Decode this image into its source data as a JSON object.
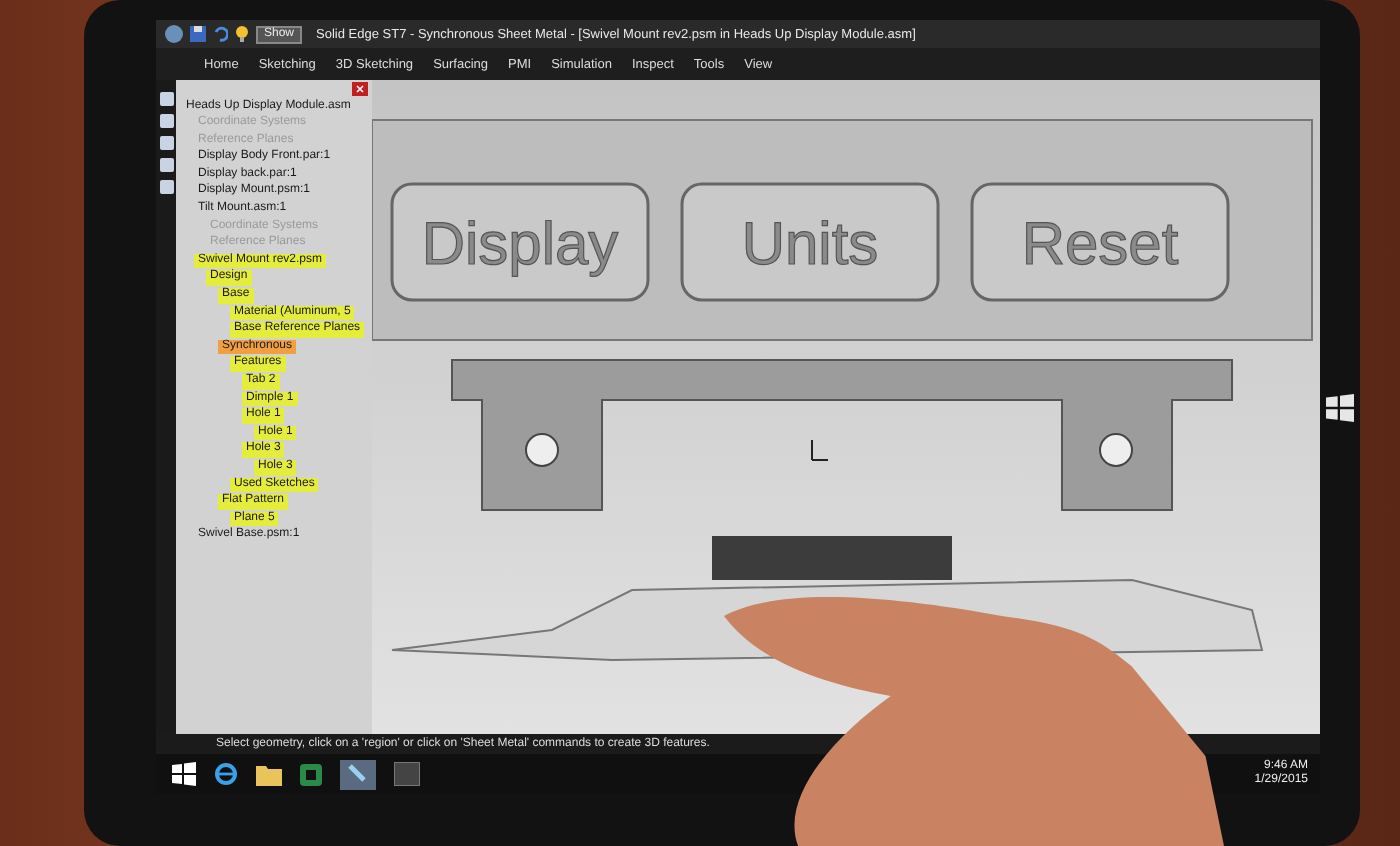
{
  "window": {
    "title": "Solid Edge ST7 - Synchronous Sheet Metal - [Swivel Mount rev2.psm in Heads Up Display Module.asm]",
    "show_button": "Show"
  },
  "ribbon_tabs": [
    {
      "label": "Home",
      "selected": false
    },
    {
      "label": "Sketching",
      "selected": false
    },
    {
      "label": "3D Sketching",
      "selected": false
    },
    {
      "label": "Surfacing",
      "selected": false
    },
    {
      "label": "PMI",
      "selected": false
    },
    {
      "label": "Simulation",
      "selected": false
    },
    {
      "label": "Inspect",
      "selected": false
    },
    {
      "label": "Tools",
      "selected": false
    },
    {
      "label": "View",
      "selected": false
    }
  ],
  "tree": [
    {
      "label": "Heads Up Display Module.asm",
      "disabled": false,
      "children": [
        {
          "label": "Coordinate Systems",
          "disabled": true
        },
        {
          "label": "Reference Planes",
          "disabled": true
        },
        {
          "label": "Display Body Front.par:1",
          "disabled": false
        },
        {
          "label": "Display back.par:1",
          "disabled": false
        },
        {
          "label": "Display Mount.psm:1",
          "disabled": false
        },
        {
          "label": "Tilt Mount.asm:1",
          "disabled": false,
          "children": [
            {
              "label": "Coordinate Systems",
              "disabled": true
            },
            {
              "label": "Reference Planes",
              "disabled": true
            }
          ]
        },
        {
          "label": "Swivel Mount rev2.psm",
          "disabled": false,
          "color": "#e4ec3c",
          "children": [
            {
              "label": "Design",
              "disabled": false,
              "color": "#e4ec3c",
              "children": [
                {
                  "label": "Base",
                  "disabled": false,
                  "color": "#e4ec3c",
                  "children": [
                    {
                      "label": "Material (Aluminum, 5",
                      "disabled": false,
                      "color": "#e4ec3c"
                    },
                    {
                      "label": "Base Reference Planes",
                      "disabled": false,
                      "color": "#e4ec3c"
                    }
                  ]
                },
                {
                  "label": "Synchronous",
                  "disabled": false,
                  "color": "#f0a040",
                  "children": [
                    {
                      "label": "Features",
                      "disabled": false,
                      "color": "#e4ec3c",
                      "children": [
                        {
                          "label": "Tab 2",
                          "disabled": false,
                          "color": "#e4ec3c"
                        },
                        {
                          "label": "Dimple 1",
                          "disabled": false,
                          "color": "#e4ec3c"
                        },
                        {
                          "label": "Hole 1",
                          "disabled": false,
                          "color": "#e4ec3c",
                          "children": [
                            {
                              "label": "Hole 1",
                              "disabled": false,
                              "color": "#e4ec3c"
                            }
                          ]
                        },
                        {
                          "label": "Hole 3",
                          "disabled": false,
                          "color": "#e4ec3c",
                          "children": [
                            {
                              "label": "Hole 3",
                              "disabled": false,
                              "color": "#e4ec3c"
                            }
                          ]
                        }
                      ]
                    },
                    {
                      "label": "Used Sketches",
                      "disabled": false,
                      "color": "#e4ec3c"
                    }
                  ]
                },
                {
                  "label": "Flat Pattern",
                  "disabled": false,
                  "color": "#e4ec3c",
                  "children": [
                    {
                      "label": "Plane 5",
                      "disabled": false,
                      "color": "#e4ec3c"
                    }
                  ]
                }
              ]
            }
          ]
        },
        {
          "label": "Swivel Base.psm:1",
          "disabled": false
        }
      ]
    }
  ],
  "model_labels": [
    "Display",
    "Units",
    "Reset"
  ],
  "status_bar": "Select geometry, click on a 'region' or click on 'Sheet Metal' commands to create 3D features.",
  "clock": {
    "time": "9:46 AM",
    "date": "1/29/2015"
  }
}
